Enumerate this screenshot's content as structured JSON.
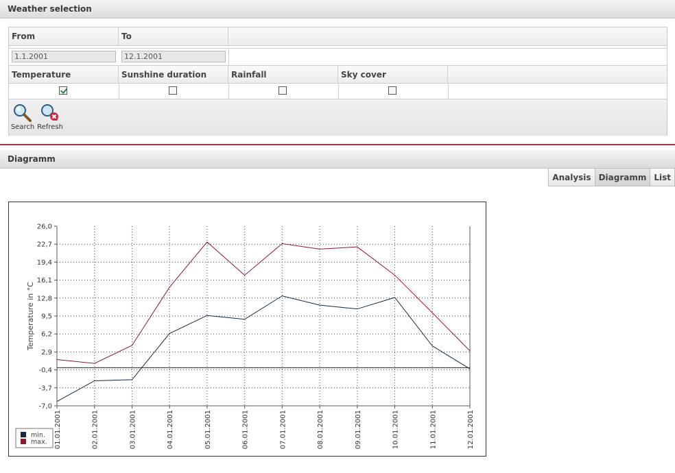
{
  "weather_panel": {
    "title": "Weather selection",
    "from_label": "From",
    "to_label": "To",
    "from_value": "1.1.2001",
    "to_value": "12.1.2001",
    "options": [
      {
        "label": "Temperature",
        "checked": true
      },
      {
        "label": "Sunshine duration",
        "checked": false
      },
      {
        "label": "Rainfall",
        "checked": false
      },
      {
        "label": "Sky cover",
        "checked": false
      }
    ],
    "toolbar": {
      "search_label": "Search",
      "search_icon": "magnifier-icon",
      "refresh_label": "Refresh",
      "refresh_icon": "magnifier-cancel-icon"
    }
  },
  "diagram_panel": {
    "title": "Diagramm",
    "tabs": [
      "Analysis",
      "Diagramm",
      "List"
    ],
    "active_tab": "Diagramm",
    "accent_color": "#b0303a"
  },
  "chart_data": {
    "type": "line",
    "ylabel": "Temperature in °C",
    "xlabel": "",
    "ylim": [
      -7.0,
      26.0
    ],
    "y_ticks": [
      "26,0",
      "22,7",
      "19,4",
      "16,1",
      "12,8",
      "9,5",
      "6,2",
      "2,9",
      "-0,4",
      "-3,7",
      "-7,0"
    ],
    "categories": [
      "01.01.2001",
      "02.01.2001",
      "03.01.2001",
      "04.01.2001",
      "05.01.2001",
      "06.01.2001",
      "07.01.2001",
      "08.01.2001",
      "09.01.2001",
      "10.01.2001",
      "11.01.2001",
      "12.01.2001"
    ],
    "series": [
      {
        "name": "min.",
        "color": "#0f2a44",
        "values": [
          -6.2,
          -2.4,
          -2.2,
          6.3,
          9.6,
          8.9,
          13.2,
          11.5,
          10.8,
          12.9,
          4.0,
          -0.2
        ]
      },
      {
        "name": "max.",
        "color": "#8b1a2a",
        "values": [
          1.5,
          0.8,
          4.1,
          14.8,
          23.1,
          17.0,
          22.8,
          21.8,
          22.2,
          17.0,
          10.1,
          3.1
        ]
      }
    ],
    "reference_line": 0.0,
    "grid": true,
    "legend_position": "bottom-left"
  }
}
